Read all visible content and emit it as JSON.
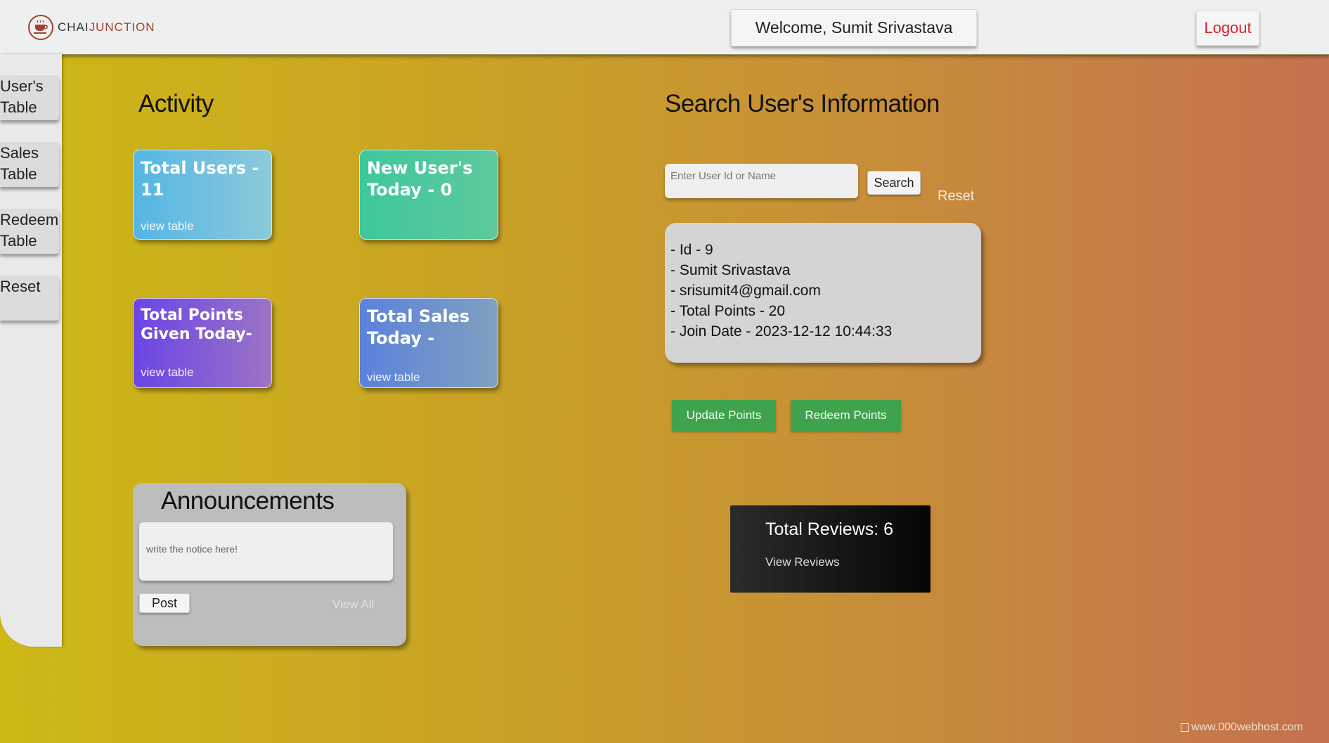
{
  "app": {
    "logo_prefix": "CHAI",
    "logo_suffix": "JUNCTION",
    "welcome": "Welcome, Sumit Srivastava",
    "logout_label": "Logout"
  },
  "sidebar": {
    "items": [
      {
        "label": "User's Table"
      },
      {
        "label": "Sales Table"
      },
      {
        "label": "Redeem Table"
      },
      {
        "label": "Reset"
      }
    ]
  },
  "activity": {
    "title": "Activity",
    "cards": [
      {
        "title": "Total Users - 11",
        "link": "view table",
        "color": "#54b6e4"
      },
      {
        "title": "New User's Today - 0",
        "link": "",
        "color": "#3ec89c"
      },
      {
        "title": "Total Points Given Today-",
        "link": "view table",
        "color": "#6b45e6"
      },
      {
        "title": "Total Sales Today -",
        "link": "view table",
        "color": "#5b82dc"
      }
    ]
  },
  "search": {
    "title": "Search User's Information",
    "placeholder": "Enter User Id or Name",
    "button_label": "Search",
    "reset_label": "Reset",
    "result_lines": [
      "- Id - 9",
      "- Sumit Srivastava",
      "- srisumit4@gmail.com",
      "- Total Points - 20",
      "- Join Date - 2023-12-12 10:44:33"
    ],
    "update_label": "Update Points",
    "redeem_label": "Redeem Points"
  },
  "reviews": {
    "title": "Total Reviews: 6",
    "link": "View Reviews"
  },
  "announcements": {
    "title": "Announcements",
    "placeholder": "write the notice here!",
    "post_label": "Post",
    "view_all_label": "View All"
  },
  "footer": {
    "watermark": "www.000webhost.com"
  },
  "colors": {
    "accent_red": "#d8262c",
    "button_green": "#3fa34d"
  }
}
